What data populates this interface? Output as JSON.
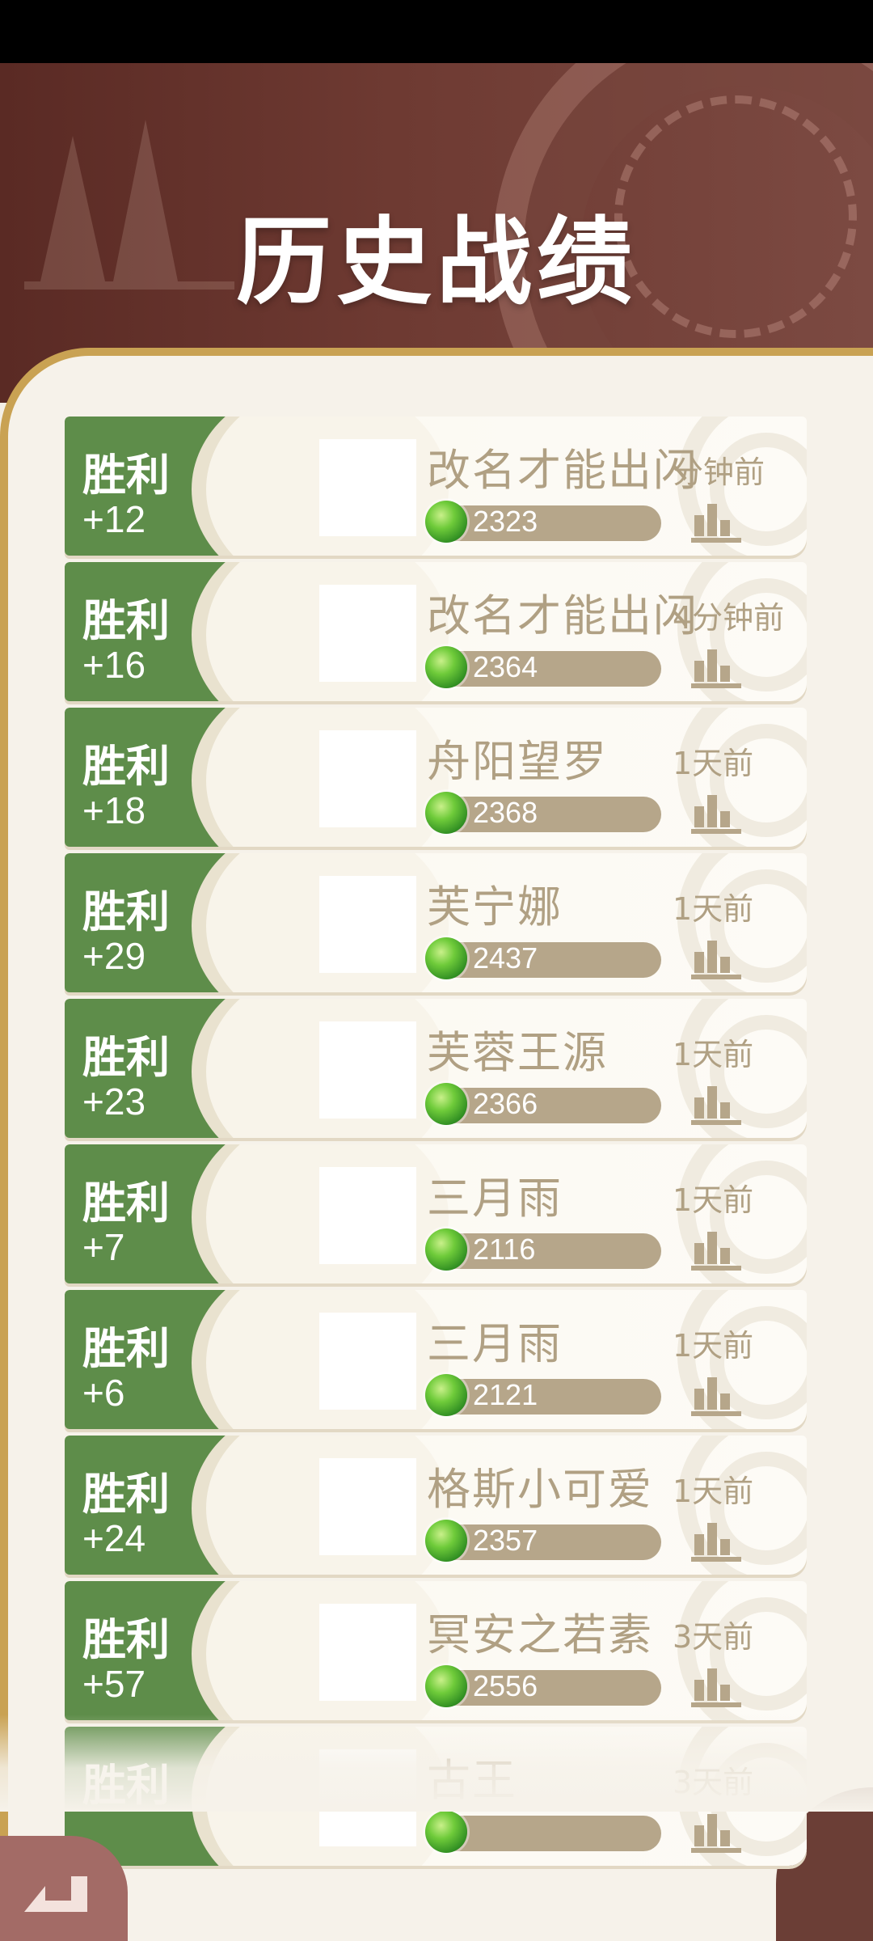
{
  "header": {
    "title": "历史战绩"
  },
  "matches": [
    {
      "result": "胜利",
      "change": "+12",
      "name": "改名才能出闪",
      "time": "分钟前",
      "rank": "2323"
    },
    {
      "result": "胜利",
      "change": "+16",
      "name": "改名才能出闪",
      "time": "4分钟前",
      "rank": "2364"
    },
    {
      "result": "胜利",
      "change": "+18",
      "name": "舟阳望罗",
      "time": "1天前",
      "rank": "2368"
    },
    {
      "result": "胜利",
      "change": "+29",
      "name": "芙宁娜",
      "time": "1天前",
      "rank": "2437"
    },
    {
      "result": "胜利",
      "change": "+23",
      "name": "芙蓉王源",
      "time": "1天前",
      "rank": "2366"
    },
    {
      "result": "胜利",
      "change": "+7",
      "name": "三月雨",
      "time": "1天前",
      "rank": "2116"
    },
    {
      "result": "胜利",
      "change": "+6",
      "name": "三月雨",
      "time": "1天前",
      "rank": "2121"
    },
    {
      "result": "胜利",
      "change": "+24",
      "name": "格斯小可爱",
      "time": "1天前",
      "rank": "2357"
    },
    {
      "result": "胜利",
      "change": "+57",
      "name": "冥安之若素",
      "time": "3天前",
      "rank": "2556"
    },
    {
      "result": "胜利",
      "change": "",
      "name": "古王",
      "time": "3天前",
      "rank": ""
    }
  ],
  "icons": {
    "rank_gem": "green-gem-icon",
    "stats": "bar-chart-icon",
    "back": "back-arrow-icon"
  },
  "colors": {
    "win_green": "#5e8d4a",
    "header_brown": "#6e3a32",
    "gold_border": "#c9a253",
    "text_tan": "#b0a083"
  }
}
